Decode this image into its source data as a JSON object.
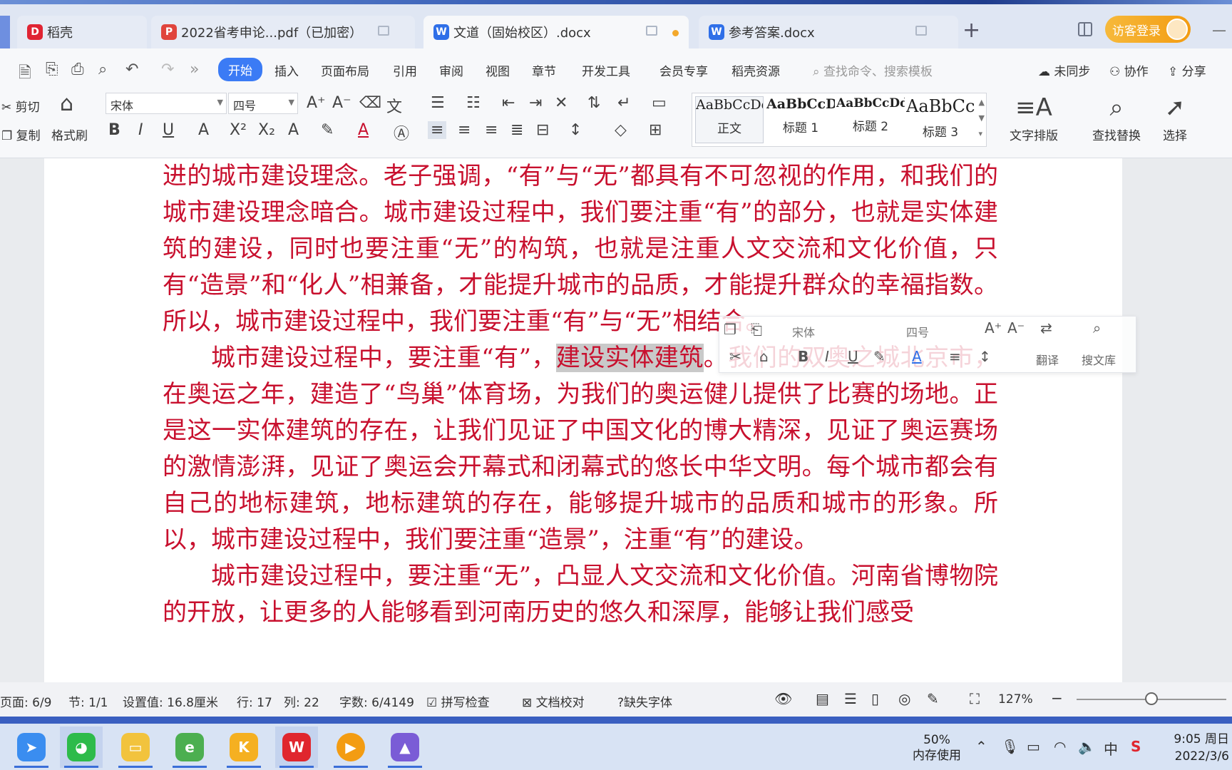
{
  "tabs": [
    {
      "label": "稻壳",
      "icon": "daoke-icon",
      "color": "#e02433"
    },
    {
      "label": "2022省考申论...pdf（已加密）",
      "icon": "pdf-icon",
      "color": "#e0443c"
    },
    {
      "label": "文道（固始校区）.docx",
      "icon": "wps-writer-icon",
      "color": "#2f6fe8"
    },
    {
      "label": "参考答案.docx",
      "icon": "wps-writer-icon",
      "color": "#2f6fe8"
    }
  ],
  "login_label": "访客登录",
  "menu": [
    "开始",
    "插入",
    "页面布局",
    "引用",
    "审阅",
    "视图",
    "章节",
    "开发工具",
    "会员专享",
    "稻壳资源"
  ],
  "search_placeholder": "查找命令、搜索模板",
  "menu_right": {
    "sync": "未同步",
    "collab": "协作",
    "share": "分享"
  },
  "ribbon": {
    "cut": "剪切",
    "copy": "复制",
    "format_painter": "格式刷",
    "font": "宋体",
    "size": "四号",
    "styles": [
      {
        "sample": "AaBbCcDd",
        "name": "正文"
      },
      {
        "sample": "AaBbCcDd",
        "name": "标题 1"
      },
      {
        "sample": "AaBbCcDd",
        "name": "标题 2"
      },
      {
        "sample": "AaBbCc",
        "name": "标题 3"
      }
    ],
    "text_layout": "文字排版",
    "find_replace": "查找替换",
    "select": "选择"
  },
  "document": {
    "p1": "进的城市建设理念。老子强调，“有”与“无”都具有不可忽视的作用，和我们的城市建设理念暗合。城市建设过程中，我们要注重“有”的部分，也就是实体建筑的建设，同时也要注重“无”的构筑，也就是注重人文交流和文化价值，只有“造景”和“化人”相兼备，才能提升城市的品质，才能提升群众的幸福指数。所以，城市建设过程中，我们要注重“有”与“无”相结合。",
    "p2_before": "城市建设过程中，要注重“有”，",
    "p2_selected": "建设实体建筑",
    "p2_after": "。我们的双奥之城北京市，在奥运之年，建造了“鸟巢”体育场，为我们的奥运健儿提供了比赛的场地。正是这一实体建筑的存在，让我们见证了中国文化的博大精深，见证了奥运赛场的激情澎湃，见证了奥运会开幕式和闭幕式的悠长中华文明。每个城市都会有自己的地标建筑，地标建筑的存在，能够提升城市的品质和城市的形象。所以，城市建设过程中，我们要注重“造景”，注重“有”的建设。",
    "p3": "城市建设过程中，要注重“无”，凸显人文交流和文化价值。河南省博物院的开放，让更多的人能够看到河南历史的悠久和深厚，能够让我们感受"
  },
  "mini_toolbar": {
    "font": "宋体",
    "size": "四号",
    "translate": "翻译",
    "search_lib": "搜文库"
  },
  "status": {
    "page": "页面: 6/9",
    "section": "节: 1/1",
    "setting": "设置值: 16.8厘米",
    "row": "行: 17",
    "col": "列: 22",
    "words": "字数: 6/4149",
    "spell": "拼写检查",
    "proofread": "文档校对",
    "missing_font": "缺失字体",
    "zoom": "127%"
  },
  "taskbar": {
    "memory_pct": "50%",
    "memory_label": "内存使用",
    "ime": "中",
    "time": "9:05 周日",
    "date": "2022/3/6"
  },
  "colors": {
    "doc_text": "#c8102e",
    "accent": "#3b7bf5",
    "login": "#f39c12"
  }
}
